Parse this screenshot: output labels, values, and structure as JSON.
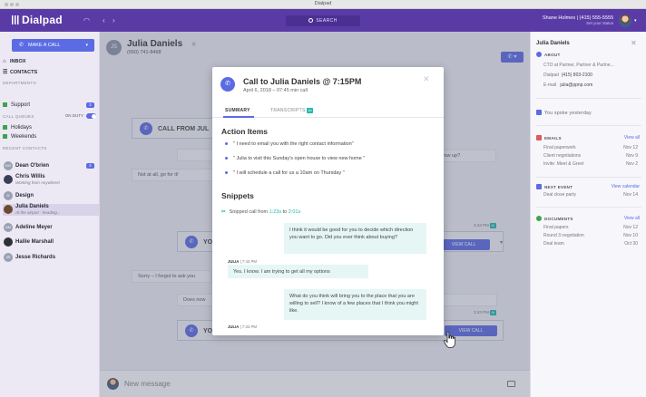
{
  "window": {
    "title": "Dialpad"
  },
  "header": {
    "brand": "Dialpad",
    "search_label": "SEARCH",
    "user": "Shane Holmes | (415) 555-5555",
    "status": "Set your status"
  },
  "sidebar": {
    "make_call": "MAKE A CALL",
    "nav": [
      {
        "label": "INBOX"
      },
      {
        "label": "CONTACTS"
      }
    ],
    "departments_label": "DEPARTMENTS",
    "departments": [
      {
        "label": "Support",
        "badge": "2"
      }
    ],
    "call_queues_label": "CALL QUEUES",
    "on_duty_label": "ON DUTY",
    "queues": [
      {
        "label": "Holidays"
      },
      {
        "label": "Weekends"
      }
    ],
    "recent_label": "RECENT CONTACTS",
    "contacts": [
      {
        "initials": "DO",
        "name": "Dean O'brien",
        "badge": "2"
      },
      {
        "initials": "",
        "name": "Chris Willis",
        "sub": "Working from Anywhere!"
      },
      {
        "initials": "D",
        "name": "Design"
      },
      {
        "initials": "",
        "name": "Julia Daniels",
        "sub": "At the airport - heading..."
      },
      {
        "initials": "AM",
        "name": "Adeline Meyer"
      },
      {
        "initials": "",
        "name": "Hallie Marshall"
      },
      {
        "initials": "JR",
        "name": "Jesse Richards"
      }
    ]
  },
  "conversation": {
    "initials": "JS",
    "name": "Julia Daniels",
    "phone": "(650) 741-8468",
    "call_from": "CALL FROM JUL",
    "messages": [
      "Thank you",
      "Not at all, go for it!",
      "llow up?",
      "Sorry – I forgot to ask you",
      "Does now"
    ],
    "call_card_label": "YO",
    "view_call": "VIEW CALL",
    "stamp": "3:43 PM",
    "composer_placeholder": "New message"
  },
  "right_panel": {
    "name": "Julia Daniels",
    "about_label": "ABOUT",
    "about_title": "CTO at Partner, Partner & Partne...",
    "dialpad_key": "Dialpad",
    "dialpad_value": "(415) 803-2100",
    "email_key": "E-mail",
    "email_value": "julia@ppnp.com",
    "spoke": "You spoke yesterday",
    "emails_label": "EMAILS",
    "view_all": "View all",
    "emails": [
      {
        "subject": "Final paperwork",
        "date": "Nov 12"
      },
      {
        "subject": "Client negotiations",
        "date": "Nov 9"
      },
      {
        "subject": "Invite: Meet & Greet",
        "date": "Nov 2"
      }
    ],
    "event_label": "NEXT EVENT",
    "view_calendar": "View calendar",
    "event": {
      "subject": "Deal close party",
      "date": "Nov 14"
    },
    "docs_label": "DOCUMENTS",
    "documents": [
      {
        "name": "Final papers",
        "date": "Nov 12"
      },
      {
        "name": "Round 3 negotiation",
        "date": "Nov 10"
      },
      {
        "name": "Deal team",
        "date": "Oct 30"
      }
    ]
  },
  "modal": {
    "title": "Call to Julia Daniels @ 7:15PM",
    "subtitle": "April 6, 2018 – 07:45 min call",
    "tab_summary": "SUMMARY",
    "tab_transcripts": "TRANSCRIPTS",
    "ai_label": "AI",
    "action_items_title": "Action Items",
    "action_items": [
      "\" I need to email you with the right contact information\"",
      "\" Julia to visit this Sunday's open house to view new home \"",
      "\" I will schedule a call for us a 10am on Thursday \""
    ],
    "snippets_title": "Snippets",
    "snippet_prefix": "Snipped call from",
    "snippet_from": "1:23s",
    "snippet_to": "to",
    "snippet_until": "2:01s",
    "transcript": [
      {
        "text": "I think it would be good for you to decide which direction you want to go. Did you ever think about buying?"
      },
      {
        "speaker": "JULIA",
        "time": "| 7:43 PM",
        "text": "Yes. I know. I am trying to get all my options"
      },
      {
        "text": "What do you think will bring you to the place that you are willing to sell? I know of a few places that I think you might like."
      },
      {
        "speaker": "JULIA",
        "time": "| 7:34 PM"
      }
    ]
  }
}
